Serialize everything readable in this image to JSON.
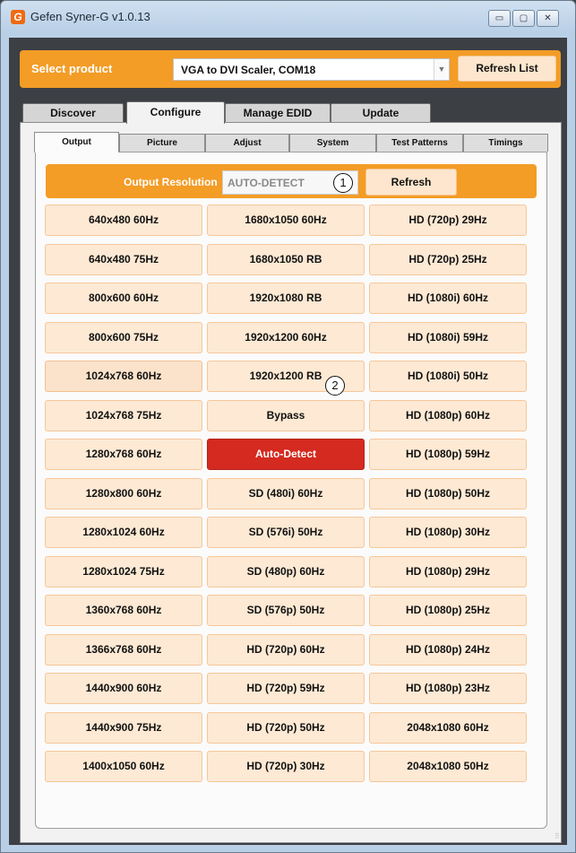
{
  "window": {
    "title": "Gefen Syner-G v1.0.13",
    "logo_letter": "G",
    "controls": {
      "minimize": "▭",
      "maximize": "▢",
      "close": "✕"
    }
  },
  "product_bar": {
    "label": "Select product",
    "selected_product": "VGA to DVI Scaler, COM18",
    "refresh_label": "Refresh List"
  },
  "main_tabs": [
    {
      "label": "Discover",
      "active": false
    },
    {
      "label": "Configure",
      "active": true
    },
    {
      "label": "Manage EDID",
      "active": false
    },
    {
      "label": "Update",
      "active": false
    }
  ],
  "sub_tabs": [
    {
      "label": "Output",
      "active": true
    },
    {
      "label": "Picture",
      "active": false
    },
    {
      "label": "Adjust",
      "active": false
    },
    {
      "label": "System",
      "active": false
    },
    {
      "label": "Test Patterns",
      "active": false
    },
    {
      "label": "Timings",
      "active": false
    }
  ],
  "output_resolution": {
    "label": "Output Resolution",
    "value": "AUTO-DETECT",
    "refresh_label": "Refresh",
    "marker": "1"
  },
  "resolutions": {
    "col1": [
      "640x480 60Hz",
      "640x480 75Hz",
      "800x600 60Hz",
      "800x600 75Hz",
      "1024x768 60Hz",
      "1024x768 75Hz",
      "1280x768 60Hz",
      "1280x800 60Hz",
      "1280x1024 60Hz",
      "1280x1024 75Hz",
      "1360x768 60Hz",
      "1366x768 60Hz",
      "1440x900 60Hz",
      "1440x900 75Hz",
      "1400x1050 60Hz"
    ],
    "col2": [
      "1680x1050 60Hz",
      "1680x1050 RB",
      "1920x1080 RB",
      "1920x1200 60Hz",
      "1920x1200 RB",
      "Bypass",
      "Auto-Detect",
      "SD (480i) 60Hz",
      "SD (576i) 50Hz",
      "SD (480p) 60Hz",
      "SD (576p) 50Hz",
      "HD (720p) 60Hz",
      "HD (720p) 59Hz",
      "HD (720p) 50Hz",
      "HD (720p) 30Hz"
    ],
    "col3": [
      "HD (720p) 29Hz",
      "HD (720p) 25Hz",
      "HD (1080i) 60Hz",
      "HD (1080i) 59Hz",
      "HD (1080i) 50Hz",
      "HD (1080p) 60Hz",
      "HD (1080p) 59Hz",
      "HD (1080p) 50Hz",
      "HD (1080p) 30Hz",
      "HD (1080p) 29Hz",
      "HD (1080p) 25Hz",
      "HD (1080p) 24Hz",
      "HD (1080p) 23Hz",
      "2048x1080 60Hz",
      "2048x1080 50Hz"
    ],
    "selected": "Auto-Detect",
    "hovered": "1024x768 60Hz",
    "selected_marker": "2"
  },
  "colors": {
    "accent": "#f39c26",
    "selected": "#d42a20",
    "button_bg": "#fde9d4"
  }
}
